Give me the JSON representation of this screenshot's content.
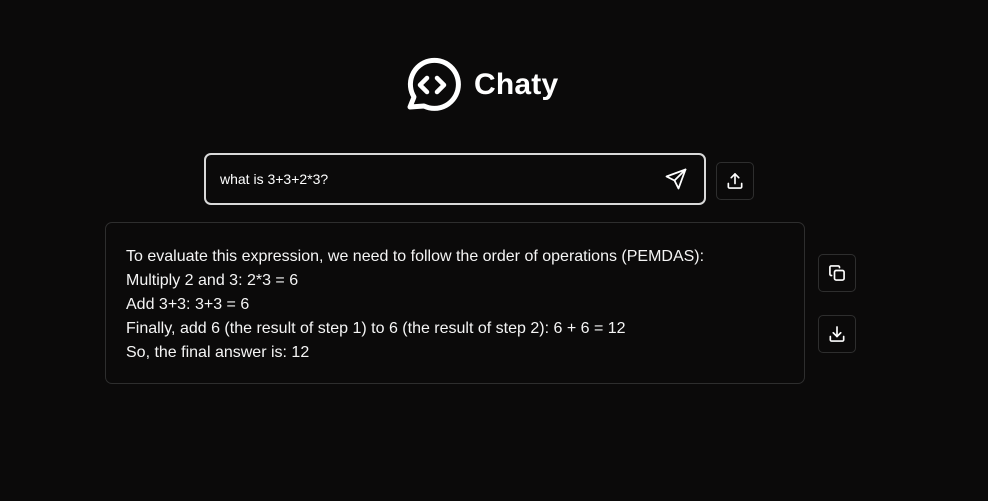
{
  "app": {
    "name": "Chaty",
    "logo_icon": "chat-bubble-code-icon"
  },
  "search": {
    "value": "what is 3+3+2*3?",
    "send_icon": "send-icon"
  },
  "actions": {
    "upload_icon": "upload-icon",
    "copy_icon": "copy-icon",
    "download_icon": "download-icon"
  },
  "answer": {
    "lines": [
      "To evaluate this expression, we need to follow the order of operations (PEMDAS):",
      "Multiply 2 and 3: 2*3 = 6",
      "Add 3+3: 3+3 = 6",
      "Finally, add 6 (the result of step 1) to 6 (the result of step 2): 6 + 6 = 12",
      "So, the final answer is: 12"
    ]
  },
  "colors": {
    "background": "#0b0a0a",
    "text": "#f5f5f5",
    "input_border": "#d9d9d9",
    "card_border": "#2e2e2e"
  }
}
